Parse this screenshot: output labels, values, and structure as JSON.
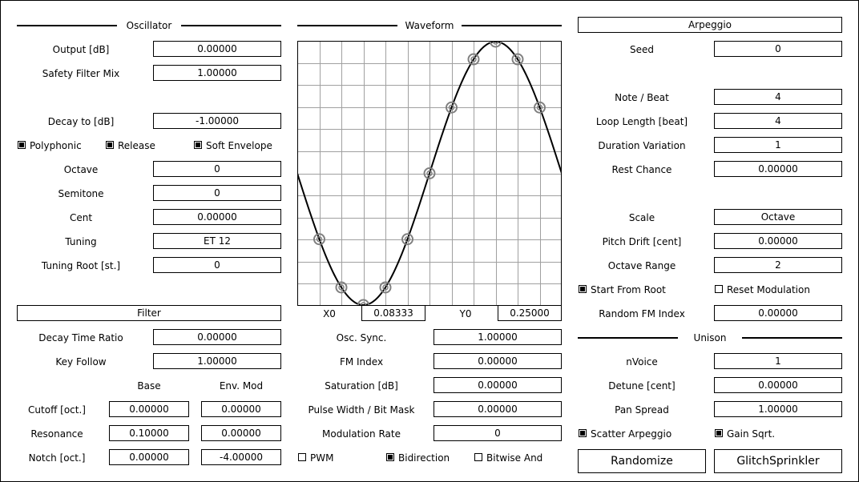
{
  "oscillator": {
    "title": "Oscillator",
    "output_label": "Output [dB]",
    "output_value": "0.00000",
    "safety_label": "Safety Filter Mix",
    "safety_value": "1.00000",
    "decay_label": "Decay to [dB]",
    "decay_value": "-1.00000",
    "polyphonic": "Polyphonic",
    "release": "Release",
    "soft_envelope": "Soft Envelope",
    "octave_label": "Octave",
    "octave_value": "0",
    "semitone_label": "Semitone",
    "semitone_value": "0",
    "cent_label": "Cent",
    "cent_value": "0.00000",
    "tuning_label": "Tuning",
    "tuning_value": "ET 12",
    "tuning_root_label": "Tuning Root [st.]",
    "tuning_root_value": "0"
  },
  "filter": {
    "title": "Filter",
    "decay_ratio_label": "Decay Time Ratio",
    "decay_ratio_value": "0.00000",
    "key_follow_label": "Key Follow",
    "key_follow_value": "1.00000",
    "base_header": "Base",
    "env_header": "Env. Mod",
    "cutoff_label": "Cutoff [oct.]",
    "cutoff_base": "0.00000",
    "cutoff_env": "0.00000",
    "resonance_label": "Resonance",
    "resonance_base": "0.10000",
    "resonance_env": "0.00000",
    "notch_label": "Notch [oct.]",
    "notch_base": "0.00000",
    "notch_env": "-4.00000"
  },
  "waveform": {
    "title": "Waveform",
    "x0_label": "X0",
    "x0_value": "0.08333",
    "y0_label": "Y0",
    "y0_value": "0.25000",
    "osc_sync_label": "Osc. Sync.",
    "osc_sync_value": "1.00000",
    "fm_index_label": "FM Index",
    "fm_index_value": "0.00000",
    "saturation_label": "Saturation [dB]",
    "saturation_value": "0.00000",
    "pulse_width_label": "Pulse Width / Bit Mask",
    "pulse_width_value": "0.00000",
    "mod_rate_label": "Modulation Rate",
    "mod_rate_value": "0",
    "pwm": "PWM",
    "bidirection": "Bidirection",
    "bitwise_and": "Bitwise And"
  },
  "arpeggio": {
    "title": "Arpeggio",
    "seed_label": "Seed",
    "seed_value": "0",
    "note_beat_label": "Note / Beat",
    "note_beat_value": "4",
    "loop_length_label": "Loop Length [beat]",
    "loop_length_value": "4",
    "duration_var_label": "Duration Variation",
    "duration_var_value": "1",
    "rest_chance_label": "Rest Chance",
    "rest_chance_value": "0.00000",
    "scale_label": "Scale",
    "scale_value": "Octave",
    "pitch_drift_label": "Pitch Drift [cent]",
    "pitch_drift_value": "0.00000",
    "octave_range_label": "Octave Range",
    "octave_range_value": "2",
    "start_from_root": "Start From Root",
    "reset_modulation": "Reset Modulation",
    "random_fm_label": "Random FM Index",
    "random_fm_value": "0.00000"
  },
  "unison": {
    "title": "Unison",
    "nvoice_label": "nVoice",
    "nvoice_value": "1",
    "detune_label": "Detune [cent]",
    "detune_value": "0.00000",
    "pan_spread_label": "Pan Spread",
    "pan_spread_value": "1.00000",
    "scatter_arpeggio": "Scatter Arpeggio",
    "gain_sqrt": "Gain Sqrt."
  },
  "buttons": {
    "randomize": "Randomize",
    "glitch": "GlitchSprinkler"
  },
  "checkbox_states": {
    "polyphonic": true,
    "release": true,
    "soft_envelope": true,
    "pwm": false,
    "bidirection": true,
    "bitwise_and": false,
    "start_from_root": true,
    "reset_modulation": false,
    "scatter_arpeggio": true,
    "gain_sqrt": true
  },
  "waveform_plot": {
    "type": "line",
    "description_curve": "sine",
    "x": [
      0,
      0.08333,
      0.16667,
      0.25,
      0.33333,
      0.41667,
      0.5,
      0.58333,
      0.66667,
      0.75,
      0.83333,
      0.91667,
      1
    ],
    "control_points_x": [
      0.08333,
      0.16667,
      0.25,
      0.33333,
      0.41667,
      0.5,
      0.58333,
      0.66667,
      0.75,
      0.83333,
      0.91667
    ],
    "curve_color": "#000000",
    "marker_color": "#808080",
    "grid_color": "#a0a0a0"
  }
}
